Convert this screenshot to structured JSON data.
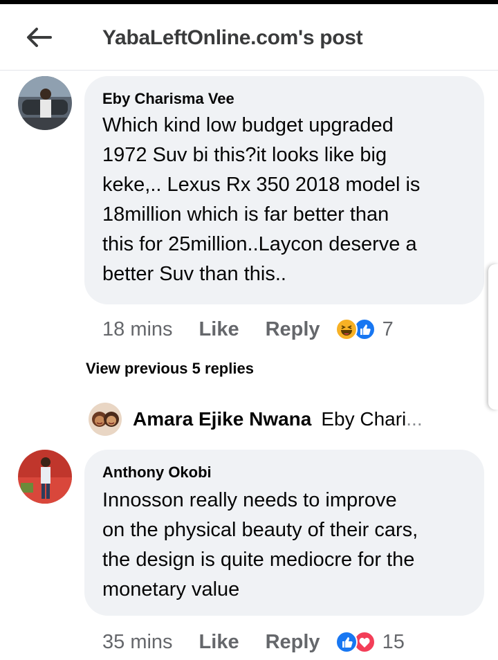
{
  "header": {
    "title": "YabaLeftOnline.com's post"
  },
  "comments": [
    {
      "author": "Eby Charisma Vee",
      "text": "Which kind low budget  upgraded\n1972 Suv bi this?it looks like big\nkeke,.. Lexus Rx 350 2018 model is\n18million which is far better than\nthis for 25million..Laycon deserve a\nbetter Suv than this..",
      "time": "18 mins",
      "like_label": "Like",
      "reply_label": "Reply",
      "reaction_count": "7",
      "reactions": [
        "haha",
        "like"
      ]
    },
    {
      "author": "Anthony Okobi",
      "text": "Innosson really needs to improve\non the physical beauty of their cars,\nthe design is quite mediocre for the\nmonetary value",
      "time": "35 mins",
      "like_label": "Like",
      "reply_label": "Reply",
      "reaction_count": "15",
      "reactions": [
        "like",
        "love"
      ]
    }
  ],
  "view_previous": "View previous 5 replies",
  "reply_preview": {
    "author": "Amara Ejike Nwana",
    "snippet": "Eby Chari",
    "ellipsis": "..."
  },
  "colors": {
    "bubble": "#f0f2f5",
    "meta_text": "#65676b",
    "like_blue": "#1877f2",
    "love_red": "#f33e58",
    "haha_yellow": "#f7b125"
  }
}
